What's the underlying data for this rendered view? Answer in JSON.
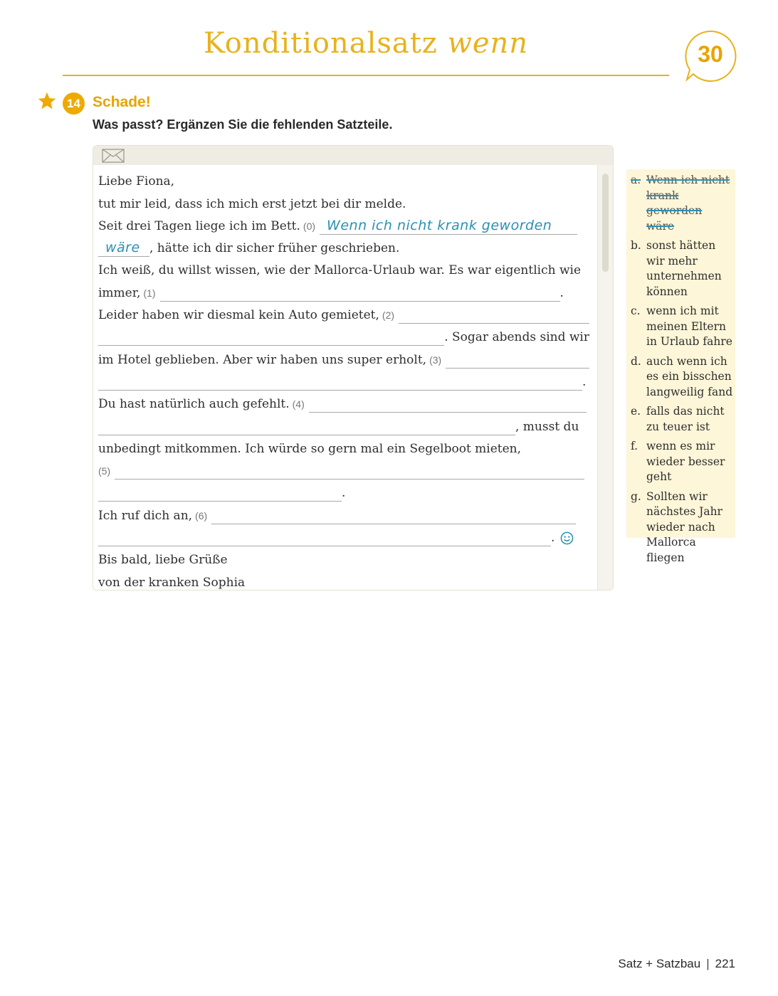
{
  "header": {
    "title_main": "Konditionalsatz",
    "title_italic": "wenn",
    "chapter_number": "30"
  },
  "exercise": {
    "number": "14",
    "title": "Schade!",
    "instruction": "Was passt? Ergänzen Sie die fehlenden Satzteile."
  },
  "email": {
    "l1": "Liebe Fiona,",
    "l2": "tut mir leid, dass ich mich erst jetzt bei dir melde.",
    "l3": "Seit drei Tagen liege ich im Bett.",
    "n0": "(0)",
    "answer_part1": "Wenn ich nicht krank geworden",
    "answer_part2": "wäre",
    "l4": ", hätte ich dir sicher früher geschrieben.",
    "l5": "Ich weiß, du willst wissen, wie der Mallorca-Urlaub war. Es war eigentlich wie",
    "l6": "immer,",
    "n1": "(1)",
    "dot": ".",
    "l7": "Leider haben wir diesmal kein Auto gemietet,",
    "n2": "(2)",
    "l8": ". Sogar abends sind wir",
    "l9": "im Hotel geblieben. Aber wir haben uns super erholt,",
    "n3": "(3)",
    "l11": "Du hast natürlich auch gefehlt.",
    "n4": "(4)",
    "l12": ", musst du",
    "l13": "unbedingt mitkommen. Ich würde so gern mal ein Segelboot mieten,",
    "n5": "(5)",
    "l16": "Ich ruf dich an,",
    "n6": "(6)",
    "l18": "Bis bald, liebe Grüße",
    "l19": "von der kranken Sophia"
  },
  "options": [
    {
      "letter": "a.",
      "text": "Wenn ich nicht krank geworden wäre"
    },
    {
      "letter": "b.",
      "text": "sonst hätten wir mehr unternehmen können"
    },
    {
      "letter": "c.",
      "text": "wenn ich mit meinen Eltern in Urlaub fahre"
    },
    {
      "letter": "d.",
      "text": "auch wenn ich es ein bisschen langweilig fand"
    },
    {
      "letter": "e.",
      "text": "falls das nicht zu teuer ist"
    },
    {
      "letter": "f.",
      "text": "wenn es mir wieder besser geht"
    },
    {
      "letter": "g.",
      "text": "Sollten wir nächstes Jahr wieder nach Mallorca fliegen"
    }
  ],
  "footer": {
    "section": "Satz + Satzbau",
    "separator": "|",
    "page": "221"
  },
  "colors": {
    "accent": "#e8b21c",
    "handwriting": "#2b8fb3",
    "options_bg": "#fdf6d8"
  }
}
